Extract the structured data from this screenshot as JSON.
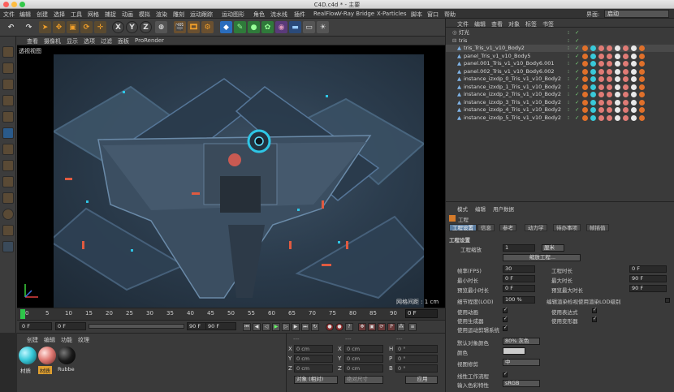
{
  "window": {
    "title": "C4D.c4d * - 主要"
  },
  "menubar": {
    "items": [
      "文件",
      "编辑",
      "创建",
      "选择",
      "工具",
      "网格",
      "捕捉",
      "动画",
      "模拟",
      "渲染",
      "雕刻",
      "运动跟踪",
      "运动图形",
      "角色",
      "流水线",
      "插件",
      "RealFlow",
      "V-Ray Bridge",
      "X-Particles",
      "脚本",
      "窗口",
      "帮助"
    ],
    "layout_label": "界面:",
    "layout_value": "启动"
  },
  "toolbar": {
    "xyz": [
      "X",
      "Y",
      "Z"
    ]
  },
  "viewport": {
    "menu": [
      "查看",
      "摄像机",
      "显示",
      "选项",
      "过滤",
      "面板",
      "ProRender"
    ],
    "label": "透视视图",
    "grid_spacing": "网格间距 : 1 cm"
  },
  "timeline": {
    "ticks": [
      "0",
      "5",
      "10",
      "15",
      "20",
      "25",
      "30",
      "35",
      "40",
      "45",
      "50",
      "55",
      "60",
      "65",
      "70",
      "75",
      "80",
      "85",
      "90"
    ],
    "frame_end": "0 F"
  },
  "transport": {
    "start": "0 F",
    "current": "0 F",
    "end": "90 F",
    "end2": "90 F"
  },
  "materials": {
    "menu": [
      "创建",
      "编辑",
      "功能",
      "纹理"
    ],
    "items": [
      {
        "label": "材质",
        "color": "#39c9d9"
      },
      {
        "label": "材质",
        "color": "#e07b75"
      },
      {
        "label": "Rubbe",
        "color": "#1a1a1a"
      }
    ]
  },
  "coords": {
    "header": [
      "---",
      "---",
      "---"
    ],
    "labels_left": [
      "X",
      "Y",
      "Z"
    ],
    "labels_mid": [
      "X",
      "Y",
      "Z"
    ],
    "labels_right": [
      "H",
      "P",
      "B"
    ],
    "values": [
      "0 cm",
      "0 cm",
      "0 cm",
      "0 cm",
      "0 cm",
      "0 cm",
      "0 °",
      "0 °",
      "0 °"
    ],
    "mode": "对象 (相对)",
    "size_mode": "绝对尺寸",
    "apply": "应用"
  },
  "objects": {
    "menu": [
      "文件",
      "编辑",
      "查看",
      "对象",
      "标签",
      "书签"
    ],
    "rows": [
      {
        "name": "灯光",
        "tags": false
      },
      {
        "name": "tris",
        "tags": false
      },
      {
        "name": "tris_Tris_v1_v10_Body2",
        "tags": true
      },
      {
        "name": "panel_Tris_v1_v10_Body5",
        "tags": true
      },
      {
        "name": "panel.001_Tris_v1_v10_Body6.001",
        "tags": true
      },
      {
        "name": "panel.002_Tris_v1_v10_Body6.002",
        "tags": true
      },
      {
        "name": "instance_izxdp_0_Tris_v1_v10_Body2",
        "tags": true
      },
      {
        "name": "instance_izxdp_1_Tris_v1_v10_Body2",
        "tags": true
      },
      {
        "name": "instance_izxdp_2_Tris_v1_v10_Body2",
        "tags": true
      },
      {
        "name": "instance_izxdp_3_Tris_v1_v10_Body2",
        "tags": true
      },
      {
        "name": "instance_izxdp_4_Tris_v1_v10_Body2",
        "tags": true
      },
      {
        "name": "instance_izxdp_5_Tris_v1_v10_Body2",
        "tags": true
      }
    ]
  },
  "attributes": {
    "menu": [
      "模式",
      "编辑",
      "用户数据"
    ],
    "title": "工程",
    "tabs": [
      "工程设置",
      "信息",
      "参考",
      "动力学",
      "待办事项",
      "帧插值"
    ],
    "section": "工程设置",
    "scale_label": "工程缩放",
    "scale_value": "1",
    "scale_unit": "厘米",
    "scale_button": "缩放工程...",
    "fps_label": "帧率(FPS)",
    "fps_value": "30",
    "project_time_label": "工程时长",
    "project_time_value": "0 F",
    "min_time_label": "最小时长",
    "min_time_value": "0 F",
    "max_time_label": "最大时长",
    "max_time_value": "90 F",
    "preview_min_label": "预览最小时长",
    "preview_min_value": "0 F",
    "preview_max_label": "预览最大时长",
    "preview_max_value": "90 F",
    "lod_label": "细节程度(LOD)",
    "lod_value": "100 %",
    "lod_render_label": "编辑渲染检视使用渲染LOD级别",
    "use_anim": "使用动画",
    "use_expr": "使用表达式",
    "use_gen": "使用生成器",
    "use_deform": "使用变形器",
    "use_motion": "使用运动剪辑系统",
    "default_color_label": "默认对象颜色",
    "default_color_value": "80% 灰色",
    "color_label": "颜色",
    "view_clip_label": "视图修剪",
    "view_clip_value": "中",
    "linear_label": "线性工作流程",
    "input_color_label": "输入色彩特性",
    "input_color_value": "sRGB"
  }
}
